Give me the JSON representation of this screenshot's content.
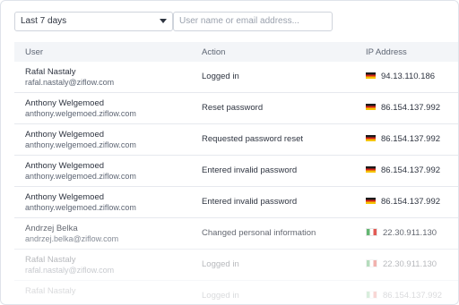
{
  "filters": {
    "period_label": "Last 7 days",
    "search_placeholder": "User name or email address..."
  },
  "table": {
    "columns": {
      "user": "User",
      "action": "Action",
      "ip": "IP Address"
    },
    "rows": [
      {
        "name": "Rafal Nastaly",
        "email": "rafal.nastaly@ziflow.com",
        "action": "Logged in",
        "country": "de",
        "ip": "94.13.110.186"
      },
      {
        "name": "Anthony Welgemoed",
        "email": "anthony.welgemoed.ziflow.com",
        "action": "Reset password",
        "country": "de",
        "ip": "86.154.137.992"
      },
      {
        "name": "Anthony Welgemoed",
        "email": "anthony.welgemoed.ziflow.com",
        "action": "Requested password reset",
        "country": "de",
        "ip": "86.154.137.992"
      },
      {
        "name": "Anthony Welgemoed",
        "email": "anthony.welgemoed.ziflow.com",
        "action": "Entered invalid password",
        "country": "de",
        "ip": "86.154.137.992"
      },
      {
        "name": "Anthony Welgemoed",
        "email": "anthony.welgemoed.ziflow.com",
        "action": "Entered invalid password",
        "country": "de",
        "ip": "86.154.137.992"
      },
      {
        "name": "Andrzej Belka",
        "email": "andrzej.belka@ziflow.com",
        "action": "Changed personal information",
        "country": "it",
        "ip": "22.30.911.130"
      },
      {
        "name": "Rafal Nastaly",
        "email": "rafal.nastaly@ziflow.com",
        "action": "Logged in",
        "country": "it",
        "ip": "22.30.911.130"
      },
      {
        "name": "Rafal Nastaly",
        "email": "",
        "action": "Logged in",
        "country": "it",
        "ip": "86.154.137.992"
      }
    ]
  }
}
